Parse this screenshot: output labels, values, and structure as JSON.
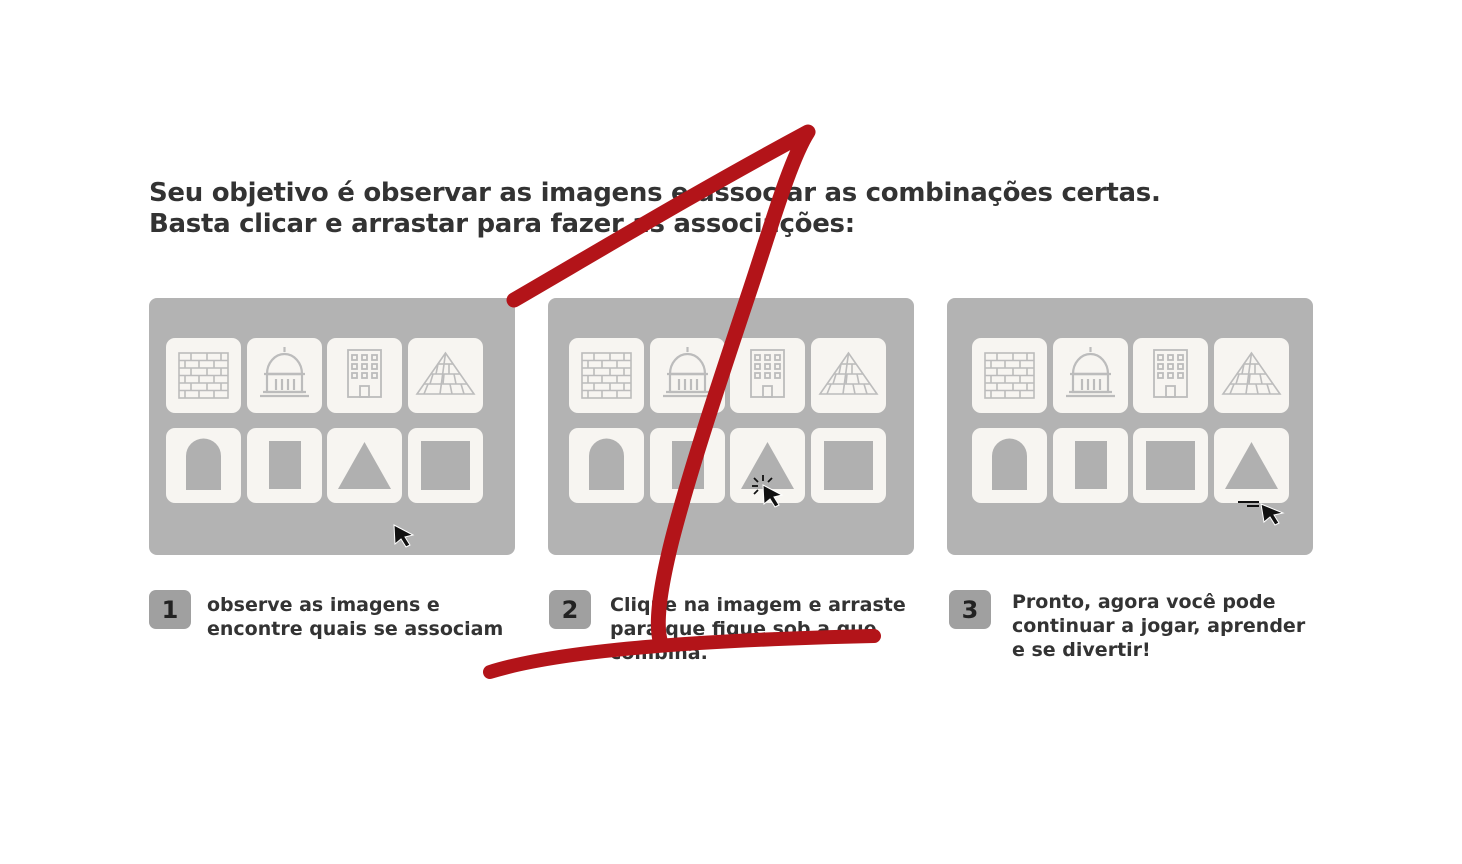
{
  "intro": {
    "line1": "Seu objetivo é observar as imagens e associar as combinações certas.",
    "line2": "Basta clicar e arrastar para fazer as associações:"
  },
  "panels": [
    {
      "top_icons": [
        "brick-wall",
        "capitol-dome",
        "office-building",
        "pyramid"
      ],
      "bottom_shapes": [
        "arch",
        "rectangle",
        "triangle",
        "square"
      ]
    },
    {
      "top_icons": [
        "brick-wall",
        "capitol-dome",
        "office-building",
        "pyramid"
      ],
      "bottom_shapes": [
        "arch",
        "rectangle",
        "triangle",
        "square"
      ]
    },
    {
      "top_icons": [
        "brick-wall",
        "capitol-dome",
        "office-building",
        "pyramid"
      ],
      "bottom_shapes": [
        "arch",
        "rectangle",
        "square",
        "triangle"
      ]
    }
  ],
  "steps": [
    {
      "number": "1",
      "line1": "observe as  imagens e",
      "line2": "encontre quais se associam",
      "line3": ""
    },
    {
      "number": "2",
      "line1": "Clique na imagem e arraste",
      "line2": "para que fique sob a que",
      "line3": "combina."
    },
    {
      "number": "3",
      "line1": "Pronto, agora você pode",
      "line2": "continuar a jogar, aprender",
      "line3": "e se divertir!"
    }
  ],
  "colors": {
    "panel": "#b3b3b3",
    "tile": "#f7f5f1",
    "icon": "#bcbcbc",
    "shape": "#b0b0b0",
    "step_badge": "#a0a0a0",
    "scribble": "#b31419",
    "text": "#333333"
  }
}
